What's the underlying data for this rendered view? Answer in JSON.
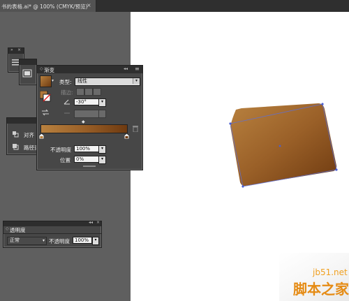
{
  "document": {
    "tab_title": "书的表格.ai* @ 100% (CMYK/预览)",
    "close_glyph": "×"
  },
  "collapsed_toolbar": {
    "header": "»",
    "close": "×"
  },
  "gradient_panel": {
    "title": "渐变",
    "collapse_glyph": "◂◂",
    "menu_glyph": "≡",
    "type_label": "类型:",
    "type_value": "线性",
    "stroke_label": "描边:",
    "angle_value": "-30°",
    "opacity_label": "不透明度",
    "opacity_value": "100%",
    "location_label": "位置",
    "location_value": "0%",
    "gradient_colors": [
      "#b8813f",
      "#9a6028",
      "#6e3a10"
    ]
  },
  "side_panel": {
    "align_label": "对齐",
    "pathfinder_label": "路径查"
  },
  "transparency_panel": {
    "title": "透明度",
    "blend_mode": "正常",
    "opacity_label": "不透明度",
    "opacity_value": "100%"
  },
  "watermark": {
    "site": "jb51.net",
    "name": "脚本之家"
  }
}
